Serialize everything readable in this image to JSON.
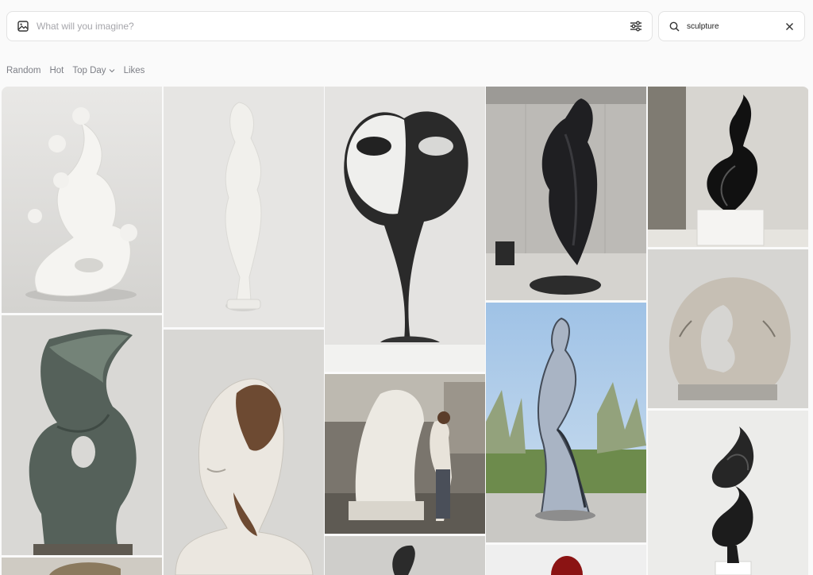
{
  "prompt": {
    "placeholder": "What will you imagine?",
    "image_icon": "image-icon",
    "settings_icon": "sliders-icon"
  },
  "search": {
    "value": "sculpture",
    "search_icon": "search-icon",
    "clear_icon": "close-icon"
  },
  "sort": {
    "items": [
      "Random",
      "Hot",
      "Top Day",
      "Likes"
    ],
    "dropdown_icon": "chevron-down-icon"
  },
  "colors": {
    "page_bg": "#fafafa",
    "field_border": "#e3e3e3",
    "placeholder_text": "#a6a6ab",
    "sort_text": "#7d7f86"
  },
  "gallery": {
    "images": [
      {
        "subject": "white abstract organic bubble sculpture"
      },
      {
        "subject": "bronze-green twisted abstract sculpture"
      },
      {
        "subject": "partial bronze sculpture"
      },
      {
        "subject": "white slender female figure sculpture"
      },
      {
        "subject": "white hollow head bust sculpture"
      },
      {
        "subject": "black and white kissing faces sculpture"
      },
      {
        "subject": "sculptor carving large white sculpture in studio"
      },
      {
        "subject": "dark curved sculpture"
      },
      {
        "subject": "black draped fabric sculpture in concrete gallery"
      },
      {
        "subject": "chrome dancer sculpture outdoors"
      },
      {
        "subject": "red glossy sculpture"
      },
      {
        "subject": "black swirling flame sculpture on marble base"
      },
      {
        "subject": "stone sculpture of two faces in ring"
      },
      {
        "subject": "black twisted ribbon sculpture on white plinth"
      }
    ]
  }
}
